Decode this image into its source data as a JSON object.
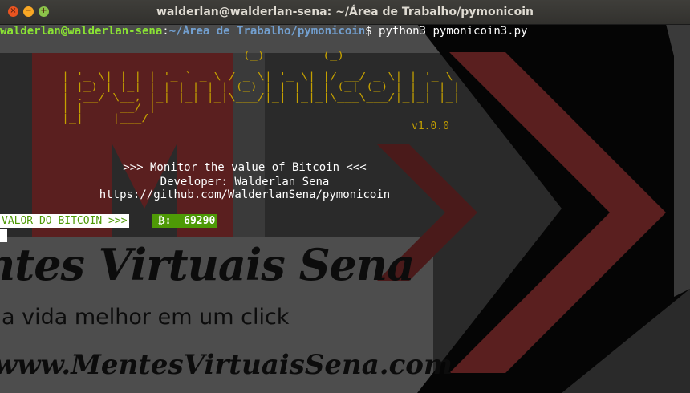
{
  "window": {
    "title": "walderlan@walderlan-sena: ~/Área de Trabalho/pymonicoin",
    "buttons": {
      "close": "×",
      "minimize": "−",
      "maximize": "+"
    }
  },
  "terminal": {
    "prompt_user": "walderlan@walderlan-sena",
    "prompt_sep": ":",
    "prompt_path": "~/Área de Trabalho/pymonicoin",
    "prompt_symbol": "$ ",
    "command": "python3 pymonicoin3.py",
    "ascii_logo": "                         (_)        (_)\n _ __  _   _ _ __ ___   ___  _ __  _  ___ ___  _ _ __\n| '_ \\| | | | '_ ` _ \\ / _ \\| '_ \\| |/ __/ _ \\| | '_ \\\n| |_) | |_| | | | | | | (_) | | | | | (_| (_) | | | | |\n| .__/ \\__, |_| |_| |_|\\___/|_| |_|_|\\___\\___/|_|_| |_|\n| |     __/ |\n|_|    |___/",
    "version": "v1.0.0",
    "info_lines": [
      ">>> Monitor the value of Bitcoin <<<",
      "Developer: Walderlan Sena",
      "https://github.com/WalderlanSena/pymonicoin"
    ],
    "valor_label": "VALOR DO BITCOIN >>>",
    "btc_symbol": "₿:",
    "btc_value": "69290"
  },
  "wallpaper": {
    "brand": "ntes Virtuais Sena",
    "slogan": "a vida melhor em um click",
    "url": "www.MentesVirtuaisSena.com"
  },
  "colors": {
    "prompt_user": "#8ae234",
    "prompt_path": "#729fcf",
    "logo": "#c4a000",
    "valor_fg": "#4e9a06",
    "btc_bg": "#4e9a06",
    "wallpaper_red": "#5a1f1f",
    "wallpaper_gray": "#4a4a4a"
  }
}
